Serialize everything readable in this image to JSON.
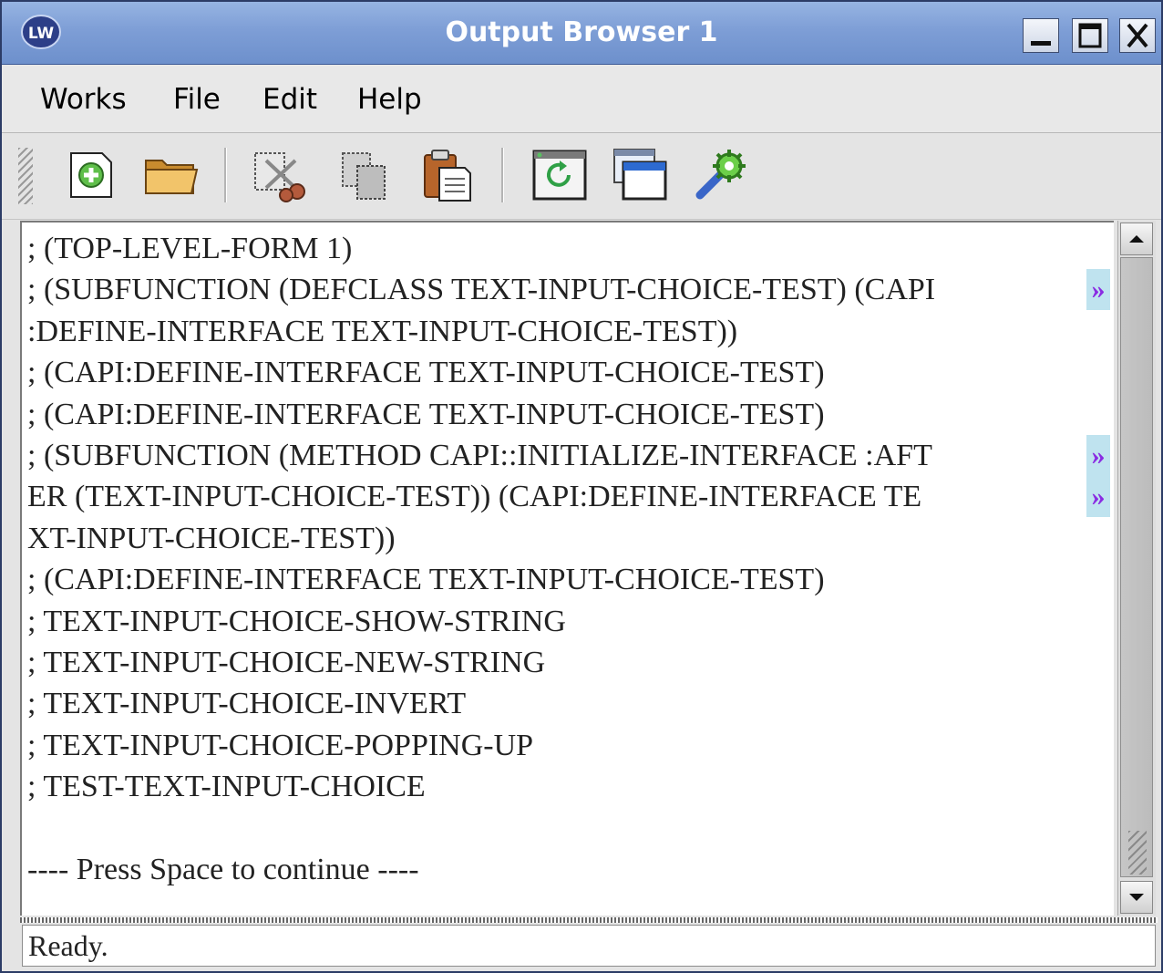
{
  "window": {
    "title": "Output Browser 1",
    "logo_text": "LW",
    "controls": [
      "minimize-icon",
      "maximize-icon",
      "close-icon"
    ]
  },
  "menubar": {
    "items": [
      {
        "label": "Works"
      },
      {
        "label": "File"
      },
      {
        "label": "Edit"
      },
      {
        "label": "Help"
      }
    ]
  },
  "toolbar": {
    "icons": [
      "new-file-icon",
      "open-folder-icon",
      "cut-icon",
      "copy-icon",
      "paste-icon",
      "refresh-icon",
      "window-icon",
      "settings-icon"
    ]
  },
  "output": {
    "lines": [
      {
        "text": "; (TOP-LEVEL-FORM 1)",
        "continued": false
      },
      {
        "text": "; (SUBFUNCTION (DEFCLASS TEXT-INPUT-CHOICE-TEST) (CAPI",
        "continued": true
      },
      {
        "text": ":DEFINE-INTERFACE TEXT-INPUT-CHOICE-TEST))",
        "continued": false
      },
      {
        "text": "; (CAPI:DEFINE-INTERFACE TEXT-INPUT-CHOICE-TEST)",
        "continued": false
      },
      {
        "text": "; (CAPI:DEFINE-INTERFACE TEXT-INPUT-CHOICE-TEST)",
        "continued": false
      },
      {
        "text": "; (SUBFUNCTION (METHOD CAPI::INITIALIZE-INTERFACE :AFT",
        "continued": true
      },
      {
        "text": "ER (TEXT-INPUT-CHOICE-TEST)) (CAPI:DEFINE-INTERFACE TE",
        "continued": true
      },
      {
        "text": "XT-INPUT-CHOICE-TEST))",
        "continued": false
      },
      {
        "text": "; (CAPI:DEFINE-INTERFACE TEXT-INPUT-CHOICE-TEST)",
        "continued": false
      },
      {
        "text": "; TEXT-INPUT-CHOICE-SHOW-STRING",
        "continued": false
      },
      {
        "text": "; TEXT-INPUT-CHOICE-NEW-STRING",
        "continued": false
      },
      {
        "text": "; TEXT-INPUT-CHOICE-INVERT",
        "continued": false
      },
      {
        "text": "; TEXT-INPUT-CHOICE-POPPING-UP",
        "continued": false
      },
      {
        "text": "; TEST-TEXT-INPUT-CHOICE",
        "continued": false
      },
      {
        "text": "",
        "continued": false
      },
      {
        "text": "---- Press Space to continue ----",
        "continued": false
      }
    ],
    "continuation_glyph": "»"
  },
  "status": {
    "text": "Ready."
  },
  "colors": {
    "titlebar": "#7e9ed6",
    "continuation_bg": "#bfe3ef",
    "continuation_fg": "#8a2be2"
  }
}
